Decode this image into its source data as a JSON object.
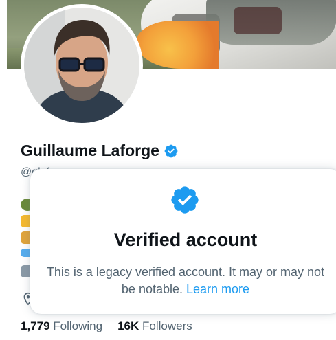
{
  "profile": {
    "name": "Guillaume Laforge",
    "handle": "@glaforge",
    "stats": {
      "following_count": "1,779",
      "following_label": "Following",
      "followers_count": "16K",
      "followers_label": "Followers"
    }
  },
  "verified_popup": {
    "title": "Verified account",
    "description": "This is a legacy verified account. It may or may not be notable.",
    "learn_more": "Learn more"
  },
  "icons": {
    "badge": "verified-badge-icon",
    "location": "location-pin-icon"
  },
  "colors": {
    "verified_blue": "#1d9bf0",
    "text_primary": "#0f1419",
    "text_secondary": "#536471"
  }
}
